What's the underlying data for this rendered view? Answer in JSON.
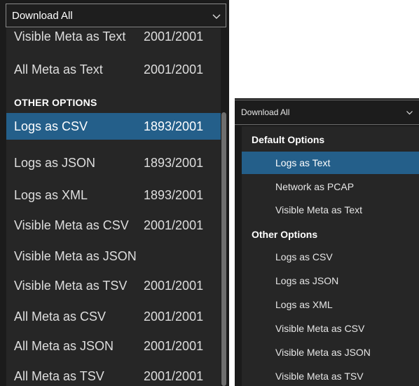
{
  "left_dropdown": {
    "header_label": "Download All",
    "rows_top": [
      {
        "name": "Visible Meta as Text",
        "count": "2001/2001"
      },
      {
        "name": "All Meta as Text",
        "count": "2001/2001"
      }
    ],
    "section_label": "OTHER OPTIONS",
    "rows": [
      {
        "name": "Logs as CSV",
        "count": "1893/2001"
      },
      {
        "name": "Logs as JSON",
        "count": "1893/2001"
      },
      {
        "name": "Logs as XML",
        "count": "1893/2001"
      },
      {
        "name": "Visible Meta as CSV",
        "count": "2001/2001"
      },
      {
        "name": "Visible Meta as JSON",
        "count": ""
      },
      {
        "name": "Visible Meta as TSV",
        "count": "2001/2001"
      },
      {
        "name": "All Meta as CSV",
        "count": "2001/2001"
      },
      {
        "name": "All Meta as JSON",
        "count": "2001/2001"
      },
      {
        "name": "All Meta as TSV",
        "count": "2001/2001"
      }
    ],
    "selected_item": "Logs as CSV"
  },
  "right_dropdown": {
    "header_label": "Download All",
    "section_default": "Default Options",
    "default_rows": [
      "Logs as Text",
      "Network as PCAP",
      "Visible Meta as Text"
    ],
    "section_other": "Other Options",
    "other_rows": [
      "Logs as CSV",
      "Logs as JSON",
      "Logs as XML",
      "Visible Meta as CSV",
      "Visible Meta as JSON",
      "Visible Meta as TSV"
    ],
    "selected_item": "Logs as Text"
  },
  "colors": {
    "background": "#1b1b1b",
    "list_background": "#262626",
    "selected": "#245f8a",
    "text": "#dedede"
  },
  "icons": {
    "dropdown": "chevron-down-icon"
  }
}
